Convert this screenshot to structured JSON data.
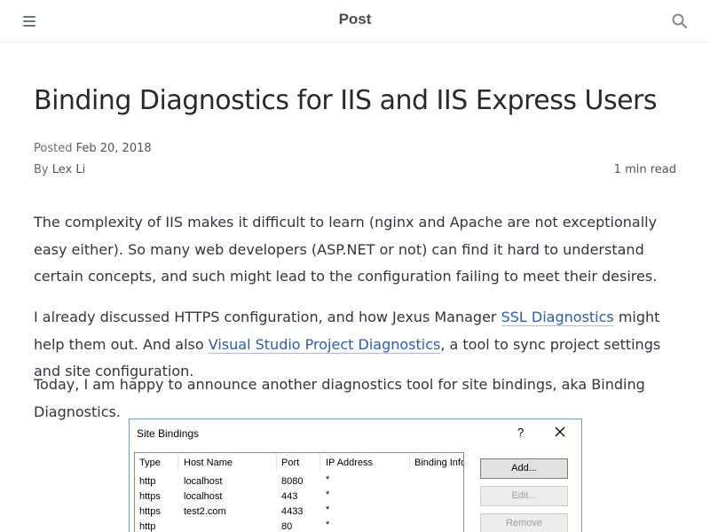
{
  "header": {
    "title": "Post",
    "menu_icon": "hamburger-menu-icon",
    "search_icon": "search-icon"
  },
  "post": {
    "title": "Binding Diagnostics for IIS and IIS Express Users",
    "posted_label": "Posted",
    "posted_date": "Feb 20, 2018",
    "by_label": "By",
    "author": "Lex Li",
    "read_time": "1 min read"
  },
  "body": {
    "p1": "The complexity of IIS makes it difficult to learn (nginx and Apache are not exceptionally easy either). So many web developers (ASP.NET or not) can find it hard to understand certain concepts, and such might lead to the configuration failing to meet their desires.",
    "p2_before": "I already discussed HTTPS configuration, and how Jexus Manager ",
    "p2_link1": "SSL Diagnostics",
    "p2_middle": " might help them out. And also ",
    "p2_link2": "Visual Studio Project Diagnostics",
    "p2_after": ", a tool to sync project settings and site configuration.",
    "p3": "Today, I am happy to announce another diagnostics tool for site bindings, aka Binding Diagnostics."
  },
  "dialog": {
    "title": "Site Bindings",
    "help": "?",
    "columns": [
      "Type",
      "Host Name",
      "Port",
      "IP Address",
      "Binding Info"
    ],
    "rows": [
      [
        "http",
        "localhost",
        "8080",
        "*"
      ],
      [
        "https",
        "localhost",
        "443",
        "*"
      ],
      [
        "https",
        "test2.com",
        "4433",
        "*"
      ],
      [
        "http",
        "",
        "80",
        "*"
      ]
    ],
    "buttons": {
      "add": "Add...",
      "edit": "Edit...",
      "remove": "Remove"
    }
  }
}
